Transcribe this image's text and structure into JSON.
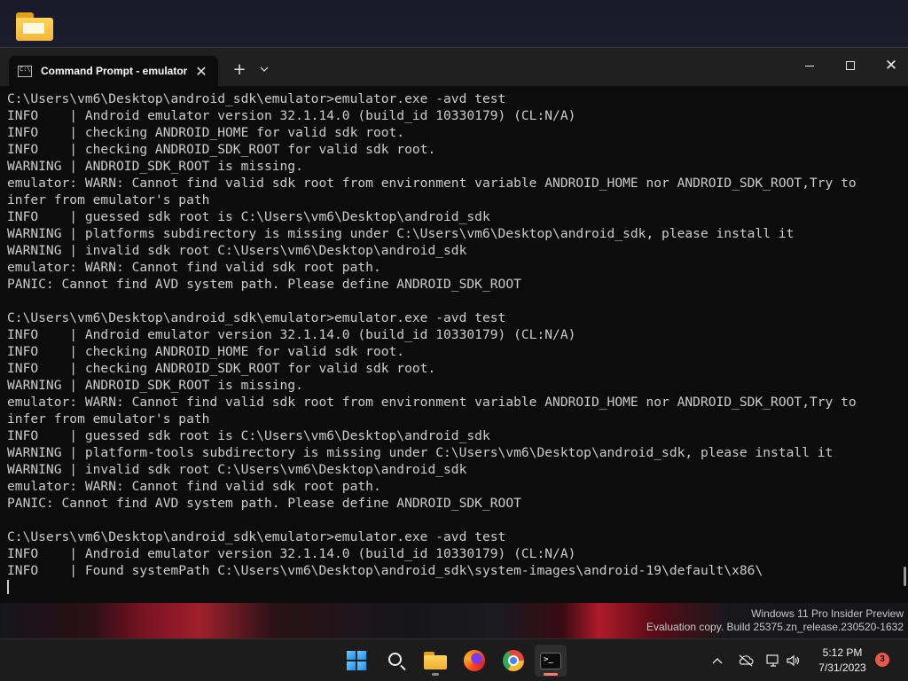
{
  "window": {
    "tab_title": "Command Prompt - emulator",
    "tab_close": "✕",
    "new_tab": "+",
    "dropdown": "⌄",
    "close_glyph": "✕"
  },
  "terminal": {
    "lines": [
      "C:\\Users\\vm6\\Desktop\\android_sdk\\emulator>emulator.exe -avd test",
      "INFO    | Android emulator version 32.1.14.0 (build_id 10330179) (CL:N/A)",
      "INFO    | checking ANDROID_HOME for valid sdk root.",
      "INFO    | checking ANDROID_SDK_ROOT for valid sdk root.",
      "WARNING | ANDROID_SDK_ROOT is missing.",
      "emulator: WARN: Cannot find valid sdk root from environment variable ANDROID_HOME nor ANDROID_SDK_ROOT,Try to",
      "infer from emulator's path",
      "INFO    | guessed sdk root is C:\\Users\\vm6\\Desktop\\android_sdk",
      "WARNING | platforms subdirectory is missing under C:\\Users\\vm6\\Desktop\\android_sdk, please install it",
      "WARNING | invalid sdk root C:\\Users\\vm6\\Desktop\\android_sdk",
      "emulator: WARN: Cannot find valid sdk root path.",
      "PANIC: Cannot find AVD system path. Please define ANDROID_SDK_ROOT",
      "",
      "C:\\Users\\vm6\\Desktop\\android_sdk\\emulator>emulator.exe -avd test",
      "INFO    | Android emulator version 32.1.14.0 (build_id 10330179) (CL:N/A)",
      "INFO    | checking ANDROID_HOME for valid sdk root.",
      "INFO    | checking ANDROID_SDK_ROOT for valid sdk root.",
      "WARNING | ANDROID_SDK_ROOT is missing.",
      "emulator: WARN: Cannot find valid sdk root from environment variable ANDROID_HOME nor ANDROID_SDK_ROOT,Try to",
      "infer from emulator's path",
      "INFO    | guessed sdk root is C:\\Users\\vm6\\Desktop\\android_sdk",
      "WARNING | platform-tools subdirectory is missing under C:\\Users\\vm6\\Desktop\\android_sdk, please install it",
      "WARNING | invalid sdk root C:\\Users\\vm6\\Desktop\\android_sdk",
      "emulator: WARN: Cannot find valid sdk root path.",
      "PANIC: Cannot find AVD system path. Please define ANDROID_SDK_ROOT",
      "",
      "C:\\Users\\vm6\\Desktop\\android_sdk\\emulator>emulator.exe -avd test",
      "INFO    | Android emulator version 32.1.14.0 (build_id 10330179) (CL:N/A)",
      "INFO    | Found systemPath C:\\Users\\vm6\\Desktop\\android_sdk\\system-images\\android-19\\default\\x86\\"
    ]
  },
  "watermark": {
    "line1": "Windows 11 Pro Insider Preview",
    "line2": "Evaluation copy. Build 25375.zn_release.230520-1632"
  },
  "taskbar": {
    "apps": [
      "start-icon",
      "search-icon",
      "file-explorer-icon",
      "firefox-icon",
      "chrome-icon",
      "terminal-icon"
    ],
    "tray": {
      "chevron": "⌃",
      "cloud": "☁",
      "network": "🖧",
      "volume": "🔊"
    },
    "time": "5:12 PM",
    "date": "7/31/2023",
    "notifications": "3"
  },
  "colors": {
    "terminal_bg": "#0c0c0c",
    "terminal_fg": "#cccccc",
    "titlebar_bg": "#202020",
    "taskbar_bg": "#1c1c1c",
    "badge": "#e8594a"
  }
}
